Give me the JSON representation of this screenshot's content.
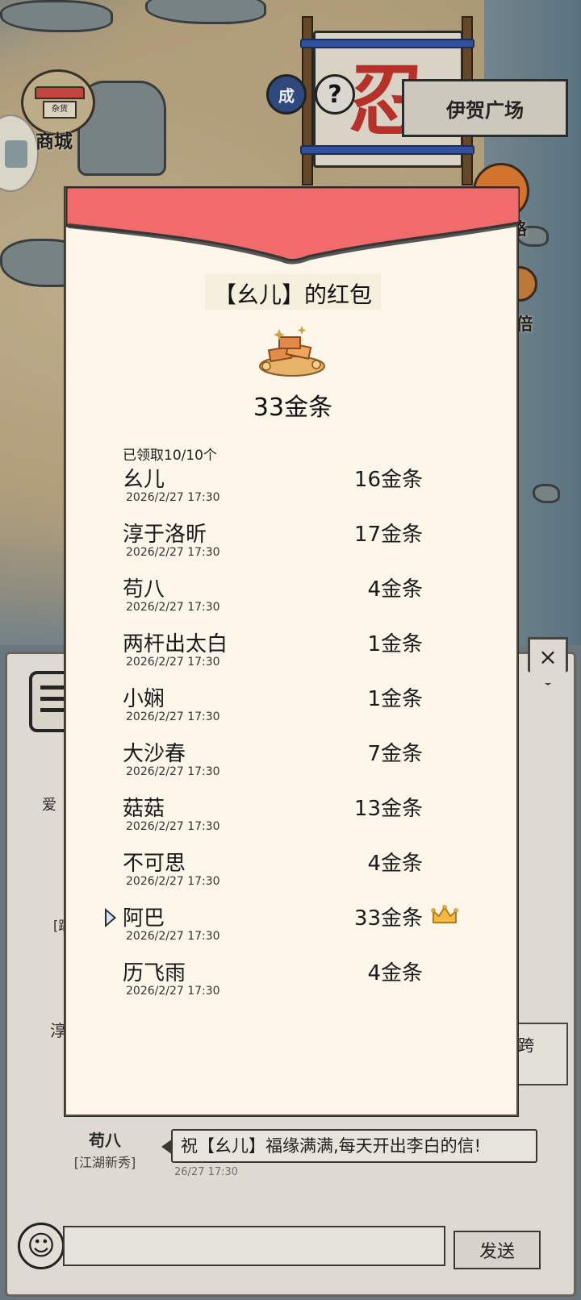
{
  "scene": {
    "shop_label": "商城",
    "shop_sign": "杂货",
    "banner_glyph": "忍",
    "achievement_icon": "成",
    "help_icon": "?",
    "plaza_button": "伊贺广场",
    "right_label_1": "路",
    "right_label_2": "x倍"
  },
  "red_packet": {
    "title": "【幺儿】的红包",
    "total": "33金条",
    "claimed_text": "已领取10/10个",
    "entries": [
      {
        "name": "幺儿",
        "time": "2026/2/27 17:30",
        "amount": "16金条"
      },
      {
        "name": "淳于洛昕",
        "time": "2026/2/27 17:30",
        "amount": "17金条"
      },
      {
        "name": "苟八",
        "time": "2026/2/27 17:30",
        "amount": "4金条"
      },
      {
        "name": "两杆出太白",
        "time": "2026/2/27 17:30",
        "amount": "1金条"
      },
      {
        "name": "小娴",
        "time": "2026/2/27 17:30",
        "amount": "1金条"
      },
      {
        "name": "大沙春",
        "time": "2026/2/27 17:30",
        "amount": "7金条"
      },
      {
        "name": "菇菇",
        "time": "2026/2/27 17:30",
        "amount": "13金条"
      },
      {
        "name": "不可思",
        "time": "2026/2/27 17:30",
        "amount": "4金条"
      },
      {
        "name": "阿巴",
        "time": "2026/2/27 17:30",
        "amount": "33金条"
      },
      {
        "name": "历飞雨",
        "time": "2026/2/27 17:30",
        "amount": "4金条"
      }
    ],
    "best_luck_icon": "crown-icon",
    "flap_color": "#f26b6b"
  },
  "chat": {
    "close_icon": "×",
    "frag_1": "爱",
    "frag_2": "[跳",
    "frag_3": "淳",
    "right_frag": "跨",
    "row_name": "苟八",
    "row_tag": "[江湖新秀]",
    "bubble_text": "祝【幺儿】福缘满满,每天开出李白的信!",
    "bubble_time": "26/27 17:30",
    "emoji_icon": "☺",
    "input_value": "",
    "send_label": "发送"
  }
}
